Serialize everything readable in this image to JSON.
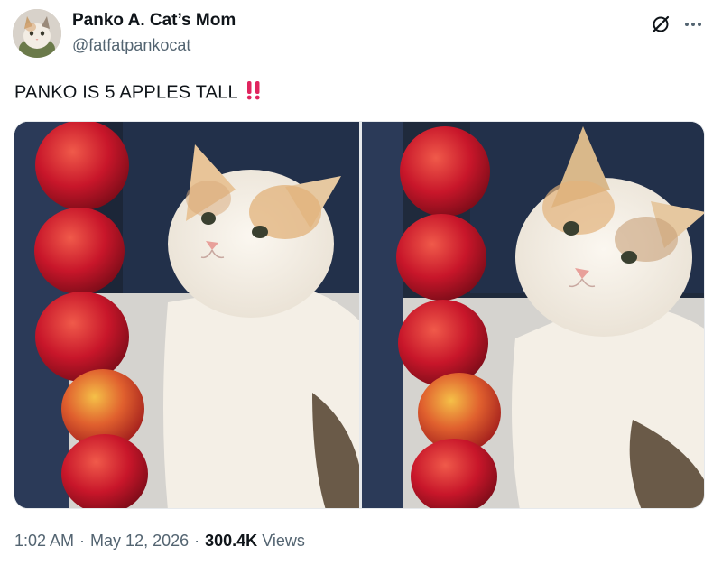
{
  "author": {
    "display_name": "Panko A. Cat’s Mom",
    "handle": "@fatfatpankocat"
  },
  "tweet": {
    "text": "PANKO IS 5 APPLES TALL",
    "emoji": "double-exclamation-mark"
  },
  "actions": {
    "grok_icon": "grok-icon",
    "more_icon": "more-icon"
  },
  "media": {
    "photo_count": 2,
    "photos": [
      {
        "subject": "calico cat beside a stack of 5 apples",
        "apple_count": 5
      },
      {
        "subject": "calico cat beside a stack of 5 apples",
        "apple_count": 5
      }
    ]
  },
  "meta": {
    "time": "1:02 AM",
    "date": "May 12, 2026",
    "separator": "·",
    "views_count": "300.4K",
    "views_label": "Views"
  },
  "colors": {
    "text_primary": "#0f1419",
    "text_secondary": "#536471",
    "emoji_red": "#e0245e"
  }
}
